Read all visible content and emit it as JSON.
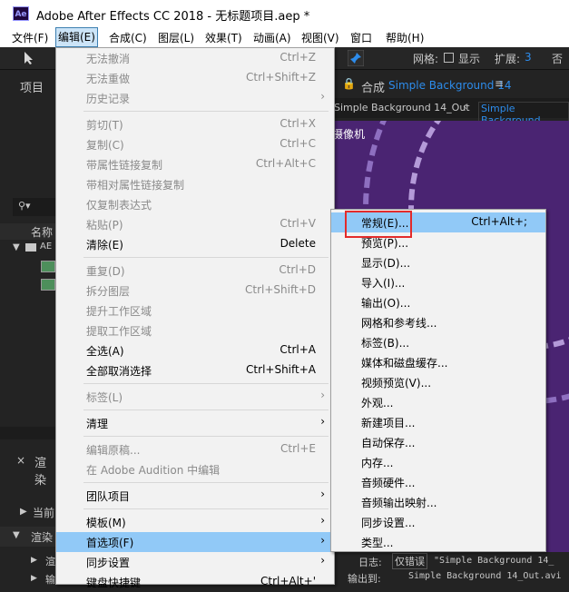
{
  "window": {
    "logo": "Ae",
    "title": "Adobe After Effects CC 2018 - 无标题项目.aep *"
  },
  "menubar": [
    {
      "label": "文件(F)"
    },
    {
      "label": "编辑(E)"
    },
    {
      "label": "合成(C)"
    },
    {
      "label": "图层(L)"
    },
    {
      "label": "效果(T)"
    },
    {
      "label": "动画(A)"
    },
    {
      "label": "视图(V)"
    },
    {
      "label": "窗口"
    },
    {
      "label": "帮助(H)"
    }
  ],
  "toolbar": {
    "grid_label": "网格:",
    "show_label": "显示",
    "expand_label": "扩展:",
    "expand_value": "3",
    "extra": "否"
  },
  "panels": {
    "project_title": "项目",
    "comp_title": "合成",
    "comp_name": "Simple Background 14",
    "comp_tab_left": "Simple Background 14_Out",
    "comp_tab_right": "Simple Background",
    "camera_label": "摄像机",
    "name_column": "名称",
    "tree_item": "AE",
    "render_title": "渲染",
    "current_label": "当前",
    "render_title2": "渲染",
    "log_label": "日志:",
    "log_value": "仅错误",
    "output_label": "输出到:",
    "output_template": "\"Simple Background 14_",
    "output_file": "Simple Background 14_Out.avi",
    "side_label_a": "渲",
    "side_label_b": "输"
  },
  "edit_menu": [
    {
      "label": "无法撤消",
      "shortcut": "Ctrl+Z",
      "disabled": true
    },
    {
      "label": "无法重做",
      "shortcut": "Ctrl+Shift+Z",
      "disabled": true
    },
    {
      "label": "历史记录",
      "shortcut": "",
      "disabled": true,
      "submenu": true
    },
    {
      "label": "剪切(T)",
      "shortcut": "Ctrl+X",
      "disabled": true
    },
    {
      "label": "复制(C)",
      "shortcut": "Ctrl+C",
      "disabled": true
    },
    {
      "label": "带属性链接复制",
      "shortcut": "Ctrl+Alt+C",
      "disabled": true
    },
    {
      "label": "带相对属性链接复制",
      "shortcut": "",
      "disabled": true
    },
    {
      "label": "仅复制表达式",
      "shortcut": "",
      "disabled": true
    },
    {
      "label": "粘贴(P)",
      "shortcut": "Ctrl+V",
      "disabled": true
    },
    {
      "label": "清除(E)",
      "shortcut": "Delete",
      "disabled": false
    },
    {
      "label": "重复(D)",
      "shortcut": "Ctrl+D",
      "disabled": true
    },
    {
      "label": "拆分图层",
      "shortcut": "Ctrl+Shift+D",
      "disabled": true
    },
    {
      "label": "提升工作区域",
      "shortcut": "",
      "disabled": true
    },
    {
      "label": "提取工作区域",
      "shortcut": "",
      "disabled": true
    },
    {
      "label": "全选(A)",
      "shortcut": "Ctrl+A",
      "disabled": false
    },
    {
      "label": "全部取消选择",
      "shortcut": "Ctrl+Shift+A",
      "disabled": false
    },
    {
      "label": "标签(L)",
      "shortcut": "",
      "disabled": true,
      "submenu": true
    },
    {
      "label": "清理",
      "shortcut": "",
      "disabled": false,
      "submenu": true
    },
    {
      "label": "编辑原稿...",
      "shortcut": "Ctrl+E",
      "disabled": true
    },
    {
      "label": "在 Adobe Audition 中编辑",
      "shortcut": "",
      "disabled": true
    },
    {
      "label": "团队项目",
      "shortcut": "",
      "disabled": false,
      "submenu": true
    },
    {
      "label": "模板(M)",
      "shortcut": "",
      "disabled": false,
      "submenu": true
    },
    {
      "label": "首选项(F)",
      "shortcut": "",
      "disabled": false,
      "submenu": true,
      "highlighted": true
    },
    {
      "label": "同步设置",
      "shortcut": "",
      "disabled": false,
      "submenu": true
    },
    {
      "label": "键盘快捷键",
      "shortcut": "Ctrl+Alt+'",
      "disabled": false
    }
  ],
  "prefs_submenu": [
    {
      "label": "常规(E)...",
      "shortcut": "Ctrl+Alt+;",
      "highlighted": true
    },
    {
      "label": "预览(P)..."
    },
    {
      "label": "显示(D)..."
    },
    {
      "label": "导入(I)..."
    },
    {
      "label": "输出(O)..."
    },
    {
      "label": "网格和参考线..."
    },
    {
      "label": "标签(B)..."
    },
    {
      "label": "媒体和磁盘缓存..."
    },
    {
      "label": "视频预览(V)..."
    },
    {
      "label": "外观..."
    },
    {
      "label": "新建项目..."
    },
    {
      "label": "自动保存..."
    },
    {
      "label": "内存..."
    },
    {
      "label": "音频硬件..."
    },
    {
      "label": "音频输出映射..."
    },
    {
      "label": "同步设置..."
    },
    {
      "label": "类型..."
    }
  ],
  "colors": {
    "menu_bg": "#f2f2f2",
    "highlight": "#91c9f7",
    "annotation_red": "#e32b2b",
    "comp_purple": "#4a2472",
    "ae_dark": "#232323"
  }
}
